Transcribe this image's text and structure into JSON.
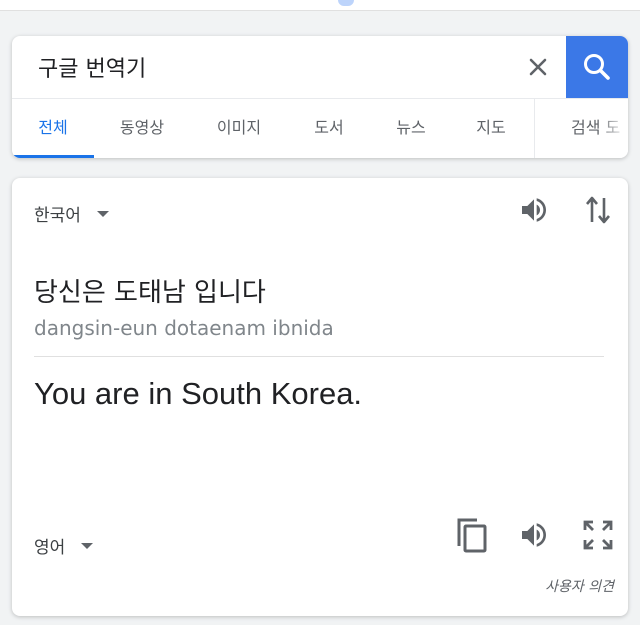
{
  "search": {
    "query": "구글 번역기",
    "clear_icon": "close-icon",
    "search_icon": "search-icon",
    "accent": "#3b78e7"
  },
  "tabs": [
    {
      "label": "전체",
      "active": true
    },
    {
      "label": "동영상"
    },
    {
      "label": "이미지"
    },
    {
      "label": "도서"
    },
    {
      "label": "뉴스"
    },
    {
      "label": "지도"
    },
    {
      "label": "검색 도"
    }
  ],
  "translate": {
    "source_lang": "한국어",
    "source_text": "당신은 도태남 입니다",
    "romanization": "dangsin-eun dotaenam ibnida",
    "target_text": "You are in South Korea.",
    "target_lang": "영어",
    "feedback": "사용자 의견",
    "icons": [
      "speaker-icon",
      "swap-icon",
      "copy-icon",
      "fullscreen-icon"
    ]
  },
  "colors": {
    "link_blue": "#1a73e8",
    "page_bg": "#f1f3f4"
  }
}
